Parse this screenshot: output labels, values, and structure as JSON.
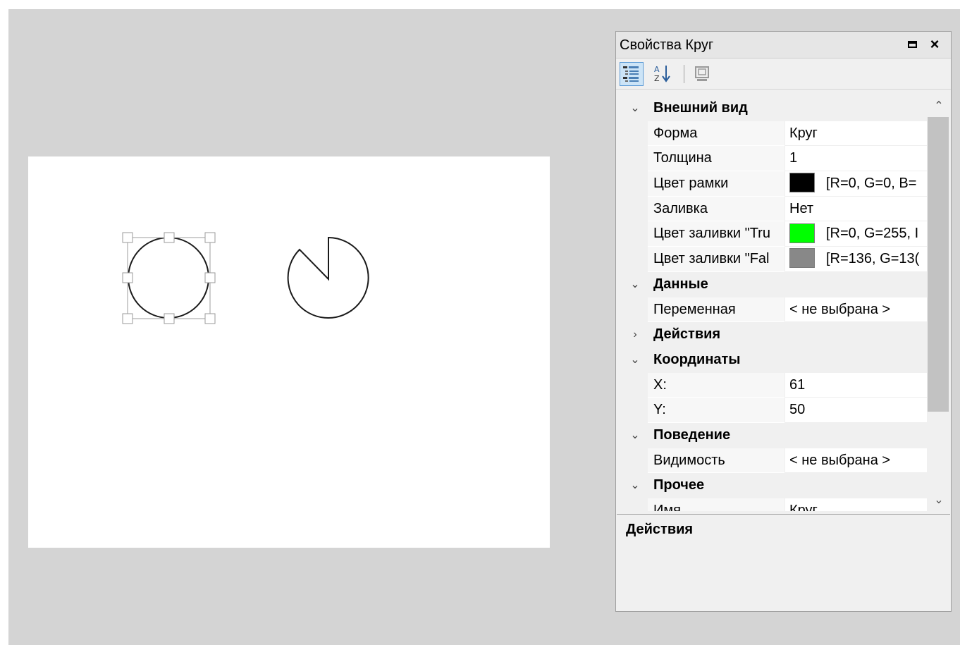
{
  "panel": {
    "title": "Свойства Круг",
    "maximize_icon": "maximize-icon",
    "close_label": "×"
  },
  "toolbar": {
    "buttons": [
      {
        "name": "categorized-icon",
        "active": true
      },
      {
        "name": "sort-alphabetical-icon",
        "active": false
      },
      {
        "name": "property-pages-icon",
        "active": false
      }
    ]
  },
  "categories": {
    "appearance": {
      "label": "Внешний вид",
      "expanded": true,
      "props": {
        "shape": {
          "name": "Форма",
          "value": "Круг"
        },
        "thickness": {
          "name": "Толщина",
          "value": "1"
        },
        "border_color": {
          "name": "Цвет рамки",
          "value": "[R=0, G=0, B=",
          "color": "#000000"
        },
        "fill": {
          "name": "Заливка",
          "value": "Нет"
        },
        "fill_true": {
          "name": "Цвет заливки \"Tru",
          "value": "[R=0, G=255, I",
          "color": "#00ff00"
        },
        "fill_false": {
          "name": "Цвет заливки \"Fal",
          "value": "[R=136, G=13(",
          "color": "#888888"
        }
      }
    },
    "data": {
      "label": "Данные",
      "expanded": true,
      "props": {
        "variable": {
          "name": "Переменная",
          "value": "< не выбрана >"
        }
      }
    },
    "actions": {
      "label": "Действия",
      "expanded": false
    },
    "coordinates": {
      "label": "Координаты",
      "expanded": true,
      "props": {
        "x": {
          "name": "X:",
          "value": "61"
        },
        "y": {
          "name": "Y:",
          "value": "50"
        }
      }
    },
    "behavior": {
      "label": "Поведение",
      "expanded": true,
      "props": {
        "visibility": {
          "name": "Видимость",
          "value": "< не выбрана >"
        }
      }
    },
    "other": {
      "label": "Прочее",
      "expanded": true,
      "props": {
        "name": {
          "name": "Имя",
          "value": "Круг"
        }
      }
    }
  },
  "icons": {
    "expanded": "⌄",
    "collapsed": "›",
    "scroll_up": "⌃",
    "scroll_down": "⌄"
  },
  "description": {
    "title": "Действия"
  },
  "colors": {
    "workspace": "#d4d4d4",
    "canvas": "#ffffff",
    "selection_handles": "#a0a0a0"
  }
}
